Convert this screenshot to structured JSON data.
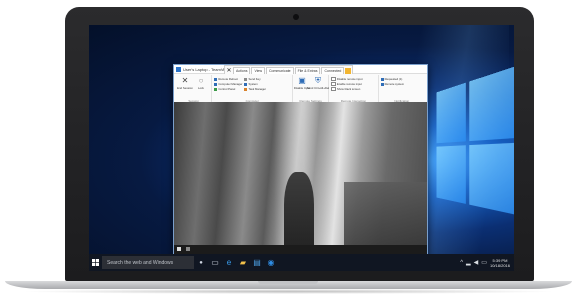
{
  "os": {
    "search_placeholder": "Search the web and Windows",
    "clock": {
      "time": "5:39 PM",
      "date": "10/18/2016"
    }
  },
  "app": {
    "title": "User's Laptop - TeamViewer",
    "connection_bar": [
      "Actions",
      "View",
      "Communicate",
      "File & Extras",
      "Connected"
    ],
    "ribbon": {
      "groups": [
        {
          "label": "Session",
          "buttons": [
            "End Session",
            "Lock"
          ]
        },
        {
          "label": "Computer",
          "buttons": [
            "Remote Reboot",
            "Computer Manager",
            "Control Panel",
            "Send Key",
            "System",
            "Task Manager"
          ]
        },
        {
          "label": "Remote Settings",
          "buttons": [
            "Disable Input",
            "Send Ctrl+Alt+Del"
          ]
        },
        {
          "label": "Remote Interaction",
          "buttons": [
            "Disable remote input",
            "Enable remote input",
            "Show black screen"
          ]
        },
        {
          "label": "Notification",
          "buttons": [
            "Requested (1)",
            "Remote system"
          ]
        }
      ]
    }
  }
}
